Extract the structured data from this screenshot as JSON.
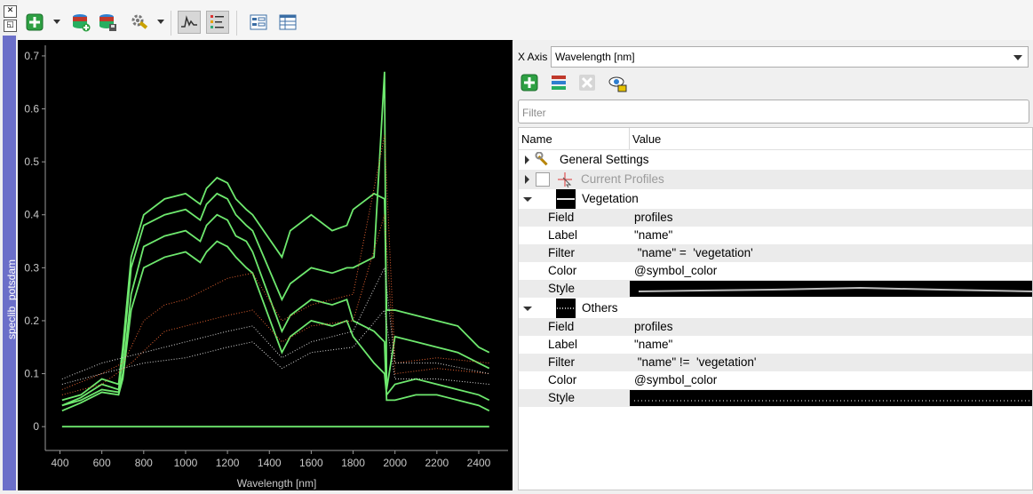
{
  "dock": {
    "title": "speclib_potsdam",
    "close_glyph": "✕",
    "float_glyph": "◱"
  },
  "toolbar": {
    "buttons": [
      {
        "name": "add-profile-button",
        "icon": "green-plus-icon",
        "has_menu": true
      },
      {
        "name": "add-layer-button",
        "icon": "database-add-icon"
      },
      {
        "name": "save-layer-button",
        "icon": "database-save-icon"
      },
      {
        "name": "tools-button",
        "icon": "wrench-gear-icon",
        "has_menu": true
      },
      {
        "name": "show-plot-button",
        "icon": "spectrum-line-icon",
        "pressed": true
      },
      {
        "name": "show-settings-button",
        "icon": "plot-settings-icon",
        "pressed": true
      },
      {
        "name": "form-view-button",
        "icon": "form-view-icon"
      },
      {
        "name": "table-view-button",
        "icon": "table-view-icon"
      }
    ]
  },
  "chart_data": {
    "type": "line",
    "background": "#000000",
    "xlabel": "Wavelength [nm]",
    "ylabel": "",
    "xlim": [
      330,
      2540
    ],
    "ylim": [
      -0.045,
      0.72
    ],
    "x_ticks": [
      400,
      600,
      800,
      1000,
      1200,
      1400,
      1600,
      1800,
      2000,
      2200,
      2400
    ],
    "y_ticks": [
      0,
      0.1,
      0.2,
      0.3,
      0.4,
      0.5,
      0.6,
      0.7
    ],
    "y_tick_labels": [
      "0",
      "0.1",
      "0.2",
      "0.3",
      "0.4",
      "0.5",
      "0.6",
      "0.7"
    ],
    "colors": {
      "vegetation": "#6ee86e",
      "others_a": "#e06030",
      "others_b": "#d8d8d8",
      "axis": "#9a9a9a"
    },
    "series": [
      {
        "group": "vegetation",
        "points": [
          [
            410,
            0.05
          ],
          [
            500,
            0.06
          ],
          [
            600,
            0.09
          ],
          [
            680,
            0.08
          ],
          [
            700,
            0.15
          ],
          [
            740,
            0.32
          ],
          [
            800,
            0.4
          ],
          [
            900,
            0.43
          ],
          [
            1000,
            0.44
          ],
          [
            1070,
            0.42
          ],
          [
            1100,
            0.45
          ],
          [
            1150,
            0.47
          ],
          [
            1200,
            0.46
          ],
          [
            1240,
            0.43
          ],
          [
            1290,
            0.41
          ],
          [
            1320,
            0.4
          ],
          [
            1460,
            0.32
          ],
          [
            1500,
            0.37
          ],
          [
            1600,
            0.4
          ],
          [
            1700,
            0.37
          ],
          [
            1770,
            0.38
          ],
          [
            1800,
            0.41
          ],
          [
            1900,
            0.44
          ],
          [
            1950,
            0.43
          ],
          [
            1960,
            0.22
          ],
          [
            2000,
            0.22
          ],
          [
            2100,
            0.21
          ],
          [
            2200,
            0.2
          ],
          [
            2300,
            0.19
          ],
          [
            2400,
            0.15
          ],
          [
            2450,
            0.14
          ]
        ]
      },
      {
        "group": "vegetation",
        "points": [
          [
            410,
            0.04
          ],
          [
            500,
            0.055
          ],
          [
            600,
            0.08
          ],
          [
            680,
            0.07
          ],
          [
            700,
            0.13
          ],
          [
            740,
            0.3
          ],
          [
            800,
            0.38
          ],
          [
            900,
            0.4
          ],
          [
            1000,
            0.41
          ],
          [
            1070,
            0.39
          ],
          [
            1100,
            0.42
          ],
          [
            1150,
            0.44
          ],
          [
            1200,
            0.43
          ],
          [
            1240,
            0.4
          ],
          [
            1290,
            0.38
          ],
          [
            1320,
            0.37
          ],
          [
            1460,
            0.24
          ],
          [
            1500,
            0.27
          ],
          [
            1600,
            0.3
          ],
          [
            1700,
            0.29
          ],
          [
            1770,
            0.3
          ],
          [
            1800,
            0.3
          ],
          [
            1900,
            0.32
          ],
          [
            1950,
            0.67
          ],
          [
            1960,
            0.07
          ],
          [
            2000,
            0.17
          ],
          [
            2100,
            0.16
          ],
          [
            2200,
            0.15
          ],
          [
            2300,
            0.14
          ],
          [
            2400,
            0.12
          ],
          [
            2450,
            0.11
          ]
        ]
      },
      {
        "group": "vegetation",
        "points": [
          [
            410,
            0.04
          ],
          [
            500,
            0.05
          ],
          [
            600,
            0.07
          ],
          [
            680,
            0.065
          ],
          [
            700,
            0.1
          ],
          [
            740,
            0.25
          ],
          [
            800,
            0.34
          ],
          [
            900,
            0.36
          ],
          [
            1000,
            0.37
          ],
          [
            1070,
            0.35
          ],
          [
            1100,
            0.38
          ],
          [
            1150,
            0.4
          ],
          [
            1200,
            0.39
          ],
          [
            1240,
            0.36
          ],
          [
            1290,
            0.35
          ],
          [
            1320,
            0.33
          ],
          [
            1460,
            0.18
          ],
          [
            1500,
            0.21
          ],
          [
            1600,
            0.24
          ],
          [
            1700,
            0.23
          ],
          [
            1770,
            0.24
          ],
          [
            1800,
            0.2
          ],
          [
            1900,
            0.18
          ],
          [
            1950,
            0.16
          ],
          [
            1960,
            0.05
          ],
          [
            2000,
            0.05
          ],
          [
            2100,
            0.06
          ],
          [
            2200,
            0.06
          ],
          [
            2300,
            0.05
          ],
          [
            2400,
            0.04
          ],
          [
            2450,
            0.03
          ]
        ]
      },
      {
        "group": "vegetation",
        "points": [
          [
            410,
            0.03
          ],
          [
            500,
            0.045
          ],
          [
            600,
            0.065
          ],
          [
            680,
            0.06
          ],
          [
            700,
            0.09
          ],
          [
            740,
            0.22
          ],
          [
            800,
            0.3
          ],
          [
            900,
            0.32
          ],
          [
            1000,
            0.33
          ],
          [
            1070,
            0.31
          ],
          [
            1100,
            0.33
          ],
          [
            1150,
            0.35
          ],
          [
            1200,
            0.34
          ],
          [
            1240,
            0.32
          ],
          [
            1290,
            0.3
          ],
          [
            1320,
            0.29
          ],
          [
            1460,
            0.14
          ],
          [
            1500,
            0.17
          ],
          [
            1600,
            0.2
          ],
          [
            1700,
            0.19
          ],
          [
            1770,
            0.2
          ],
          [
            1800,
            0.17
          ],
          [
            1900,
            0.12
          ],
          [
            1950,
            0.1
          ],
          [
            1960,
            0.06
          ],
          [
            2000,
            0.08
          ],
          [
            2100,
            0.09
          ],
          [
            2200,
            0.08
          ],
          [
            2300,
            0.07
          ],
          [
            2400,
            0.06
          ],
          [
            2450,
            0.05
          ]
        ]
      },
      {
        "group": "vegetation",
        "points": [
          [
            410,
            0.0
          ],
          [
            700,
            0.0
          ],
          [
            1000,
            0.0
          ],
          [
            1320,
            0.0
          ],
          [
            1460,
            0.0
          ],
          [
            1800,
            0.0
          ],
          [
            2000,
            0.0
          ],
          [
            2450,
            0.0
          ]
        ]
      },
      {
        "group": "others_a",
        "dashed": true,
        "points": [
          [
            410,
            0.07
          ],
          [
            600,
            0.1
          ],
          [
            700,
            0.12
          ],
          [
            740,
            0.15
          ],
          [
            800,
            0.2
          ],
          [
            900,
            0.23
          ],
          [
            1000,
            0.24
          ],
          [
            1100,
            0.26
          ],
          [
            1200,
            0.28
          ],
          [
            1320,
            0.29
          ],
          [
            1460,
            0.2
          ],
          [
            1600,
            0.23
          ],
          [
            1800,
            0.25
          ],
          [
            1950,
            0.55
          ],
          [
            2000,
            0.12
          ],
          [
            2200,
            0.13
          ],
          [
            2450,
            0.12
          ]
        ]
      },
      {
        "group": "others_a",
        "dashed": true,
        "points": [
          [
            410,
            0.06
          ],
          [
            600,
            0.08
          ],
          [
            740,
            0.12
          ],
          [
            900,
            0.18
          ],
          [
            1000,
            0.19
          ],
          [
            1100,
            0.2
          ],
          [
            1200,
            0.21
          ],
          [
            1320,
            0.22
          ],
          [
            1460,
            0.16
          ],
          [
            1600,
            0.19
          ],
          [
            1800,
            0.2
          ],
          [
            1950,
            0.4
          ],
          [
            2000,
            0.1
          ],
          [
            2200,
            0.11
          ],
          [
            2450,
            0.1
          ]
        ]
      },
      {
        "group": "others_b",
        "dashed": true,
        "points": [
          [
            410,
            0.09
          ],
          [
            600,
            0.12
          ],
          [
            800,
            0.14
          ],
          [
            1000,
            0.16
          ],
          [
            1200,
            0.18
          ],
          [
            1320,
            0.19
          ],
          [
            1460,
            0.13
          ],
          [
            1600,
            0.16
          ],
          [
            1800,
            0.18
          ],
          [
            1950,
            0.3
          ],
          [
            2000,
            0.12
          ],
          [
            2200,
            0.12
          ],
          [
            2450,
            0.1
          ]
        ]
      },
      {
        "group": "others_b",
        "dashed": true,
        "points": [
          [
            410,
            0.08
          ],
          [
            600,
            0.1
          ],
          [
            800,
            0.12
          ],
          [
            1000,
            0.13
          ],
          [
            1200,
            0.15
          ],
          [
            1320,
            0.16
          ],
          [
            1460,
            0.11
          ],
          [
            1600,
            0.14
          ],
          [
            1800,
            0.15
          ],
          [
            1950,
            0.22
          ],
          [
            2000,
            0.09
          ],
          [
            2200,
            0.09
          ],
          [
            2450,
            0.08
          ]
        ]
      }
    ]
  },
  "settings": {
    "xaxis_label": "X Axis",
    "xaxis_value": "Wavelength [nm]",
    "actions": [
      {
        "name": "add-visualization-button",
        "icon": "green-plus-icon"
      },
      {
        "name": "add-profile-layer-button",
        "icon": "layers-icon"
      },
      {
        "name": "remove-visualization-button",
        "icon": "remove-icon"
      },
      {
        "name": "toggle-visibility-button",
        "icon": "eye-icon"
      }
    ],
    "filter_placeholder": "Filter",
    "tree": {
      "col_name": "Name",
      "col_value": "Value",
      "general": "General Settings",
      "current": "Current Profiles",
      "vegetation": {
        "title": "Vegetation",
        "rows": [
          {
            "k": "Field",
            "v": "profiles"
          },
          {
            "k": "Label",
            "v": "\"name\""
          },
          {
            "k": "Filter",
            "v": " \"name\" =  'vegetation'"
          },
          {
            "k": "Color",
            "v": "@symbol_color"
          },
          {
            "k": "Style",
            "v": ""
          }
        ]
      },
      "others": {
        "title": "Others",
        "rows": [
          {
            "k": "Field",
            "v": "profiles"
          },
          {
            "k": "Label",
            "v": "\"name\""
          },
          {
            "k": "Filter",
            "v": " \"name\" !=  'vegetation'"
          },
          {
            "k": "Color",
            "v": "@symbol_color"
          },
          {
            "k": "Style",
            "v": ""
          }
        ]
      }
    }
  }
}
